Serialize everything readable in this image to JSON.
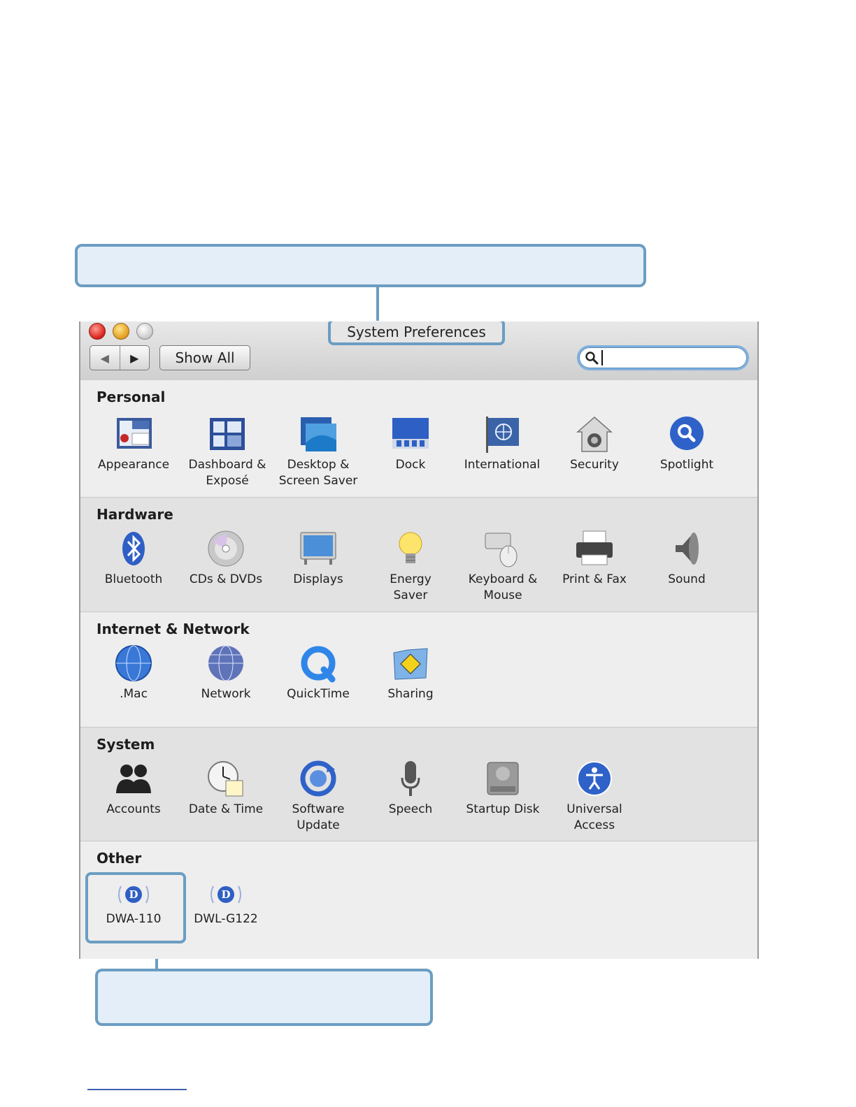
{
  "window": {
    "title": "System Preferences",
    "nav_back": "◀",
    "nav_forward": "▶",
    "show_all": "Show All",
    "search_value": ""
  },
  "sections": [
    {
      "title": "Personal",
      "items": [
        {
          "label": "Appearance",
          "icon": "appearance-icon"
        },
        {
          "label": "Dashboard &\nExposé",
          "icon": "dashboard-expose-icon"
        },
        {
          "label": "Desktop &\nScreen Saver",
          "icon": "desktop-screen-saver-icon"
        },
        {
          "label": "Dock",
          "icon": "dock-icon"
        },
        {
          "label": "International",
          "icon": "international-flag-icon"
        },
        {
          "label": "Security",
          "icon": "security-house-icon"
        },
        {
          "label": "Spotlight",
          "icon": "spotlight-magnifier-icon"
        }
      ]
    },
    {
      "title": "Hardware",
      "items": [
        {
          "label": "Bluetooth",
          "icon": "bluetooth-icon"
        },
        {
          "label": "CDs & DVDs",
          "icon": "cd-dvd-icon"
        },
        {
          "label": "Displays",
          "icon": "display-monitor-icon"
        },
        {
          "label": "Energy\nSaver",
          "icon": "lightbulb-icon"
        },
        {
          "label": "Keyboard &\nMouse",
          "icon": "keyboard-mouse-icon"
        },
        {
          "label": "Print & Fax",
          "icon": "printer-icon"
        },
        {
          "label": "Sound",
          "icon": "speaker-icon"
        }
      ]
    },
    {
      "title": "Internet & Network",
      "items": [
        {
          "label": ".Mac",
          "icon": "mac-globe-icon"
        },
        {
          "label": "Network",
          "icon": "network-globe-icon"
        },
        {
          "label": "QuickTime",
          "icon": "quicktime-icon"
        },
        {
          "label": "Sharing",
          "icon": "sharing-folder-icon"
        }
      ]
    },
    {
      "title": "System",
      "items": [
        {
          "label": "Accounts",
          "icon": "accounts-people-icon"
        },
        {
          "label": "Date & Time",
          "icon": "clock-calendar-icon"
        },
        {
          "label": "Software\nUpdate",
          "icon": "software-update-icon"
        },
        {
          "label": "Speech",
          "icon": "microphone-icon"
        },
        {
          "label": "Startup Disk",
          "icon": "startup-disk-icon"
        },
        {
          "label": "Universal\nAccess",
          "icon": "universal-access-icon"
        }
      ]
    },
    {
      "title": "Other",
      "items": [
        {
          "label": "DWA-110",
          "icon": "dlink-wireless-icon"
        },
        {
          "label": "DWL-G122",
          "icon": "dlink-wireless-icon"
        }
      ]
    }
  ],
  "colors": {
    "callout_border": "#6b9dc2",
    "callout_fill": "#e4eef8",
    "accent_blue": "#2f62c9"
  }
}
